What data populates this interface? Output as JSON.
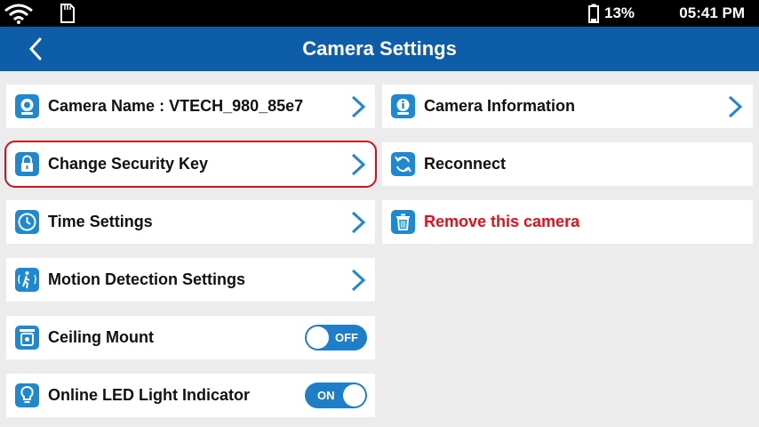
{
  "status_bar": {
    "battery_percent": "13%",
    "time": "05:41 PM"
  },
  "header": {
    "title": "Camera Settings"
  },
  "left_items": [
    {
      "label": "Camera Name : VTECH_980_85e7",
      "icon": "camera-icon"
    },
    {
      "label": "Change Security Key",
      "icon": "lock-icon",
      "selected": true
    },
    {
      "label": "Time Settings",
      "icon": "clock-icon"
    },
    {
      "label": "Motion Detection Settings",
      "icon": "motion-icon"
    },
    {
      "label": "Ceiling Mount",
      "icon": "ceiling-mount-icon",
      "toggle": "OFF"
    },
    {
      "label": "Online LED Light Indicator",
      "icon": "lightbulb-icon",
      "toggle": "ON"
    }
  ],
  "right_items": [
    {
      "label": "Camera Information",
      "icon": "info-camera-icon"
    },
    {
      "label": "Reconnect",
      "icon": "refresh-icon"
    },
    {
      "label": "Remove this camera",
      "icon": "trash-icon",
      "danger": true
    }
  ],
  "colors": {
    "accent": "#0e5da8",
    "icon_bg": "#1e88d0",
    "danger": "#e3101c",
    "toggle": "#1e7fc8"
  }
}
